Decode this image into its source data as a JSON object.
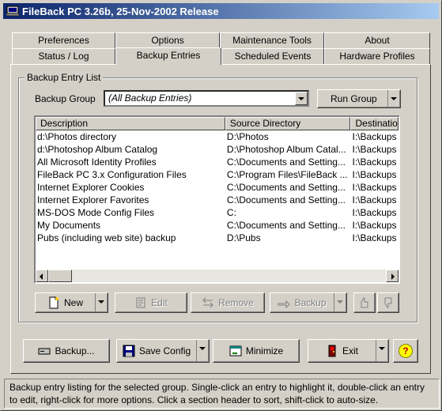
{
  "window": {
    "title": "FileBack PC 3.26b, 25-Nov-2002 Release"
  },
  "tabs": {
    "row_back": [
      {
        "label": "Preferences"
      },
      {
        "label": "Options"
      },
      {
        "label": "Maintenance Tools"
      },
      {
        "label": "About"
      }
    ],
    "row_front": [
      {
        "label": "Status / Log"
      },
      {
        "label": "Backup Entries",
        "active": true
      },
      {
        "label": "Scheduled Events"
      },
      {
        "label": "Hardware Profiles"
      }
    ]
  },
  "backup_entry_list": {
    "group_title": "Backup Entry List",
    "group_label": "Backup Group",
    "group_value": "(All Backup Entries)",
    "run_group_label": "Run Group",
    "columns": [
      "Description",
      "Source Directory",
      "Destinatio"
    ],
    "rows": [
      [
        "d:\\Photos directory",
        "D:\\Photos",
        "I:\\Backups"
      ],
      [
        "d:\\Photoshop Album Catalog",
        "D:\\Photoshop Album Catal...",
        "I:\\Backups"
      ],
      [
        "All Microsoft Identity Profiles",
        "C:\\Documents and Setting...",
        "I:\\Backups"
      ],
      [
        "FileBack PC 3.x Configuration Files",
        "C:\\Program Files\\FileBack ...",
        "I:\\Backups"
      ],
      [
        "Internet Explorer Cookies",
        "C:\\Documents and Setting...",
        "I:\\Backups"
      ],
      [
        "Internet Explorer Favorites",
        "C:\\Documents and Setting...",
        "I:\\Backups"
      ],
      [
        "MS-DOS Mode Config Files",
        "C:",
        "I:\\Backups"
      ],
      [
        "My Documents",
        "C:\\Documents and Setting...",
        "I:\\Backups"
      ],
      [
        "Pubs (including web site) backup",
        "D:\\Pubs",
        "I:\\Backups"
      ]
    ]
  },
  "entry_toolbar": {
    "new_label": "New",
    "edit_label": "Edit",
    "remove_label": "Remove",
    "backup_label": "Backup"
  },
  "bottom_bar": {
    "backup_label": "Backup...",
    "save_config_label": "Save Config",
    "minimize_label": "Minimize",
    "exit_label": "Exit",
    "help_label": "?"
  },
  "status_text": "Backup entry listing for the selected group.  Single-click an entry to highlight it, double-click an entry to edit, right-click for more options.  Click a section header to sort, shift-click to auto-size.",
  "colors": {
    "title_start": "#0a246a",
    "title_end": "#a6caf0",
    "face": "#d4d0c8",
    "help_yellow": "#ffff00"
  }
}
